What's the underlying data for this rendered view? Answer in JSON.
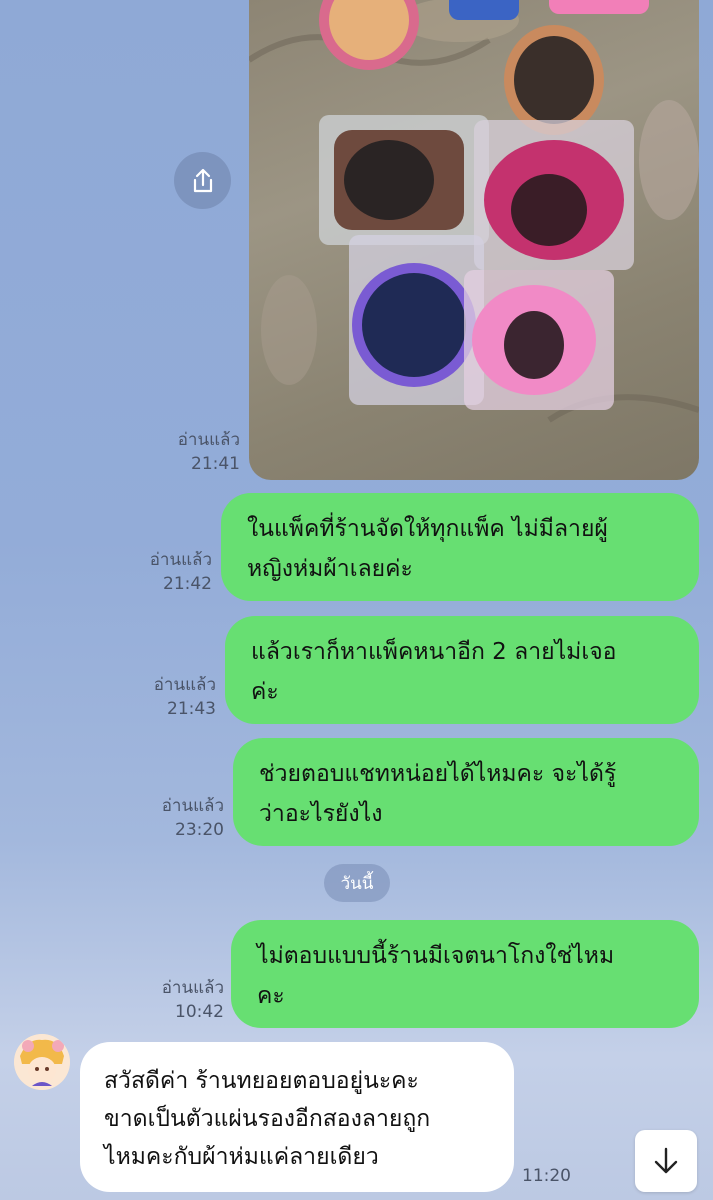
{
  "photo": {
    "alt": "sticker packs photo"
  },
  "messages": [
    {
      "type": "out",
      "read": "อ่านแล้ว",
      "time": "21:42",
      "lines": [
        "ในแพ็คที่ร้านจัดให้ทุกแพ็ค ไม่มีลายผู้",
        "หญิงห่มผ้าเลยค่ะ"
      ]
    },
    {
      "type": "out",
      "read": "อ่านแล้ว",
      "time": "21:43",
      "lines": [
        "แล้วเราก็หาแพ็คหนาอีก 2 ลายไม่เจอ",
        "ค่ะ"
      ]
    },
    {
      "type": "out",
      "read": "อ่านแล้ว",
      "time": "23:20",
      "lines": [
        "ช่วยตอบแชทหน่อยได้ไหมคะ จะได้รู้",
        "ว่าอะไรยังไง"
      ]
    },
    {
      "type": "out",
      "read": "อ่านแล้ว",
      "time": "10:42",
      "lines": [
        "ไม่ตอบแบบนี้ร้านมีเจตนาโกงใช่ไหม",
        "คะ"
      ]
    },
    {
      "type": "in",
      "time": "11:20",
      "lines": [
        "สวัสดีค่า ร้านทยอยตอบอยู่นะคะ",
        "ขาดเป็นตัวแผ่นรองอีกสองลายถูก",
        "ไหมคะกับผ้าห่มแค่ลายเดียว"
      ]
    }
  ],
  "photo_meta": {
    "read": "อ่านแล้ว",
    "time": "21:41"
  },
  "day_separator": "วันนี้",
  "colors": {
    "outgoing_bubble": "#67df72",
    "incoming_bubble": "#ffffff",
    "background": "#93acd8"
  },
  "icons": {
    "share": "share-icon",
    "scroll": "arrow-down-icon"
  }
}
